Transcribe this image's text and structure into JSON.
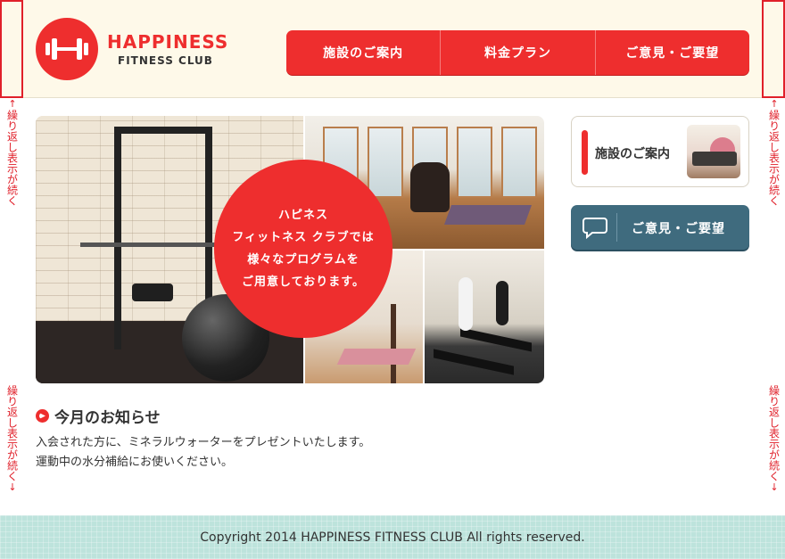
{
  "logo": {
    "title": "HAPPINESS",
    "subtitle": "FITNESS CLUB"
  },
  "gnav": [
    {
      "label": "施設のご案内"
    },
    {
      "label": "料金プラン"
    },
    {
      "label": "ご意見・ご要望"
    }
  ],
  "markers": {
    "label": "繰り返し表示が続く",
    "up_arrow": "↑",
    "down_arrow": "↓",
    "color": "#e0202a"
  },
  "hero": {
    "lines": [
      "ハピネス",
      "フィットネス クラブでは",
      "様々なプログラムを",
      "ご用意しております。"
    ]
  },
  "side": {
    "facility_label": "施設のご案内",
    "opinion_label": "ご意見・ご要望"
  },
  "news": {
    "title": "今月のお知らせ",
    "lines": [
      "入会された方に、ミネラルウォーターをプレゼントいたします。",
      "運動中の水分補給にお使いください。"
    ]
  },
  "footer": {
    "copyright": "Copyright 2014 HAPPINESS FITNESS CLUB All rights reserved."
  },
  "colors": {
    "brand_red": "#ee2e2e",
    "header_bg": "#fef9e9",
    "opinion_blue": "#3f6b7e",
    "footer_bg": "#bde3dc"
  }
}
